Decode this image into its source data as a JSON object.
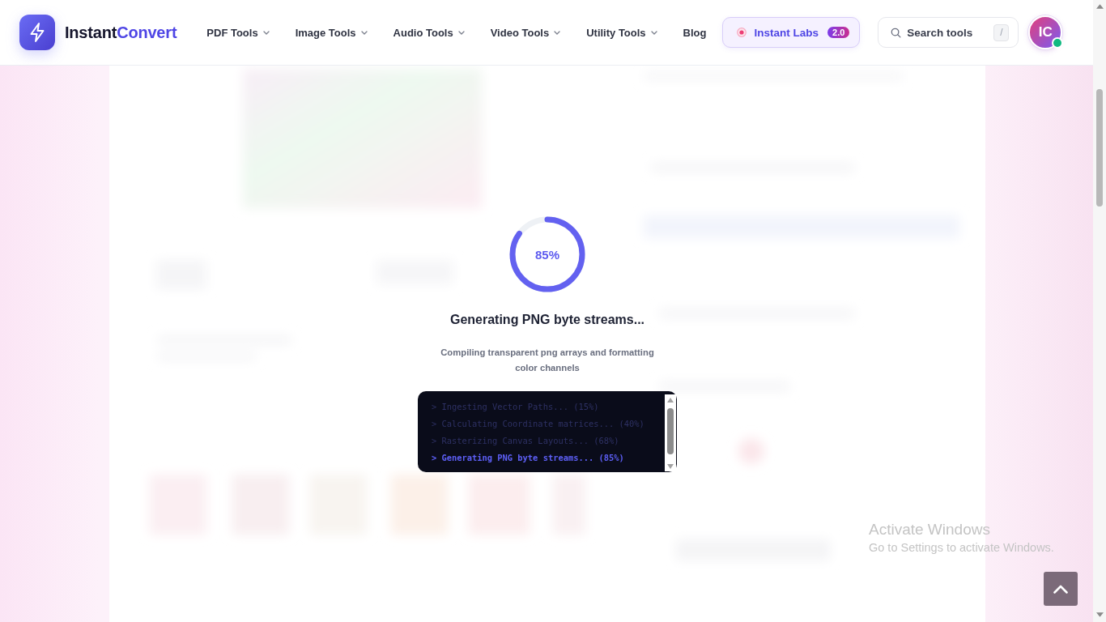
{
  "header": {
    "logo": {
      "name": "Instant",
      "accent": "Convert"
    },
    "nav": [
      {
        "label": "PDF Tools",
        "dropdown": true
      },
      {
        "label": "Image Tools",
        "dropdown": true
      },
      {
        "label": "Audio Tools",
        "dropdown": true
      },
      {
        "label": "Video Tools",
        "dropdown": true
      },
      {
        "label": "Utility Tools",
        "dropdown": true
      },
      {
        "label": "Blog",
        "dropdown": false
      }
    ],
    "labs_button": {
      "label": "Instant Labs",
      "badge": "2.0"
    },
    "search": {
      "placeholder": "Search tools",
      "shortcut": "/"
    },
    "user": {
      "initials": "IC",
      "online": true
    }
  },
  "loader": {
    "progress": {
      "level": 0.85,
      "reading": "85%"
    },
    "title": "Generating PNG byte streams...",
    "subtitle": "Compiling transparent png arrays and formatting color channels",
    "log": [
      {
        "text": "> Ingesting Vector Paths... (15%)",
        "current": false
      },
      {
        "text": "> Calculating Coordinate matrices... (40%)",
        "current": false
      },
      {
        "text": "> Rasterizing Canvas Layouts... (68%)",
        "current": false
      },
      {
        "text": "> Generating PNG byte streams... (85%)",
        "current": true
      }
    ]
  },
  "windows_notice": {
    "title": "Activate Windows",
    "message": "Go to Settings to activate Windows."
  }
}
